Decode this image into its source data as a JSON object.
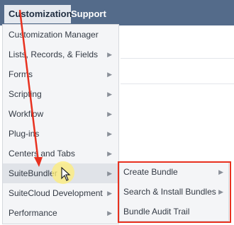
{
  "topnav": {
    "tabs": [
      {
        "label": "Customization"
      },
      {
        "label": "Support"
      }
    ]
  },
  "menu": {
    "items": [
      {
        "label": "Customization Manager",
        "has_submenu": false
      },
      {
        "label": "Lists, Records, & Fields",
        "has_submenu": true
      },
      {
        "label": "Forms",
        "has_submenu": true
      },
      {
        "label": "Scripting",
        "has_submenu": true
      },
      {
        "label": "Workflow",
        "has_submenu": true
      },
      {
        "label": "Plug-ins",
        "has_submenu": true
      },
      {
        "label": "Centers and Tabs",
        "has_submenu": true
      },
      {
        "label": "SuiteBundler",
        "has_submenu": true,
        "active": true
      },
      {
        "label": "SuiteCloud Development",
        "has_submenu": true
      },
      {
        "label": "Performance",
        "has_submenu": true
      }
    ]
  },
  "submenu": {
    "items": [
      {
        "label": "Create Bundle",
        "has_submenu": true
      },
      {
        "label": "Search & Install Bundles",
        "has_submenu": true
      },
      {
        "label": "Bundle Audit Trail",
        "has_submenu": false
      }
    ]
  },
  "icons": {
    "submenu_arrow": "chevron-right-icon",
    "cursor": "mouse-pointer-icon"
  },
  "colors": {
    "nav_bar": "#546b8a",
    "annotation_red": "#e8311f",
    "cursor_highlight": "#ffee78"
  }
}
